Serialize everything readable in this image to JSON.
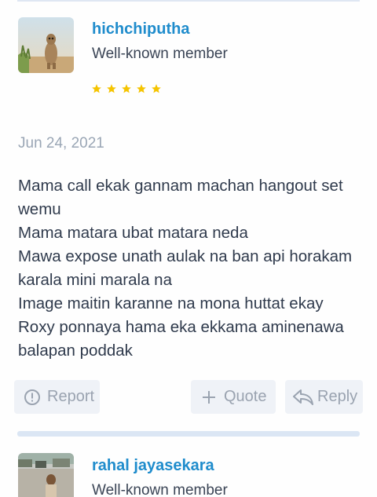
{
  "post": {
    "username": "hichchiputha",
    "user_title": "Well-known member",
    "rating_stars": 5,
    "date": "Jun 24, 2021",
    "body_lines": [
      "Mama call ekak gannam machan hangout set wemu",
      "Mama matara ubat matara neda",
      "Mawa expose unath aulak na ban api horakam karala mini marala na",
      "Image maitin karanne na mona huttat ekay",
      "Roxy ponnaya hama eka ekkama aminenawa balapan poddak"
    ],
    "actions": {
      "report_label": "Report",
      "quote_label": "Quote",
      "reply_label": "Reply"
    }
  },
  "next_post": {
    "username": "rahal jayasekara",
    "user_title": "Well-known member"
  },
  "colors": {
    "username": "#1f8ccc",
    "star": "#f5c400",
    "divider": "#dbe6f4"
  },
  "icons": [
    "exclamation-circle-icon",
    "plus-icon",
    "reply-arrow-icon",
    "star-icon"
  ]
}
